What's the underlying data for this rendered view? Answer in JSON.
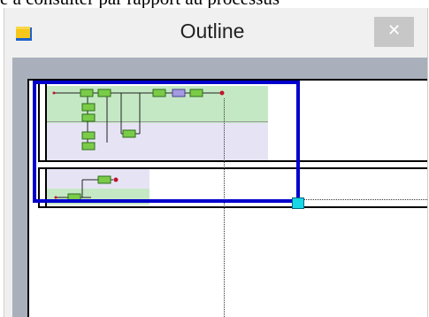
{
  "caption": "e à consulter par rapport au processus",
  "window": {
    "title": "Outline",
    "close_glyph": "✕",
    "app_icon": "folder-icon",
    "close_icon": "close-icon"
  },
  "colors": {
    "viewport_border": "#0000cc",
    "pool_green": "#c4e8c4",
    "pool_lavender": "#e6e4f4",
    "handle": "#19d6e6",
    "chrome": "#efefef",
    "panel": "#a9b0bb"
  }
}
